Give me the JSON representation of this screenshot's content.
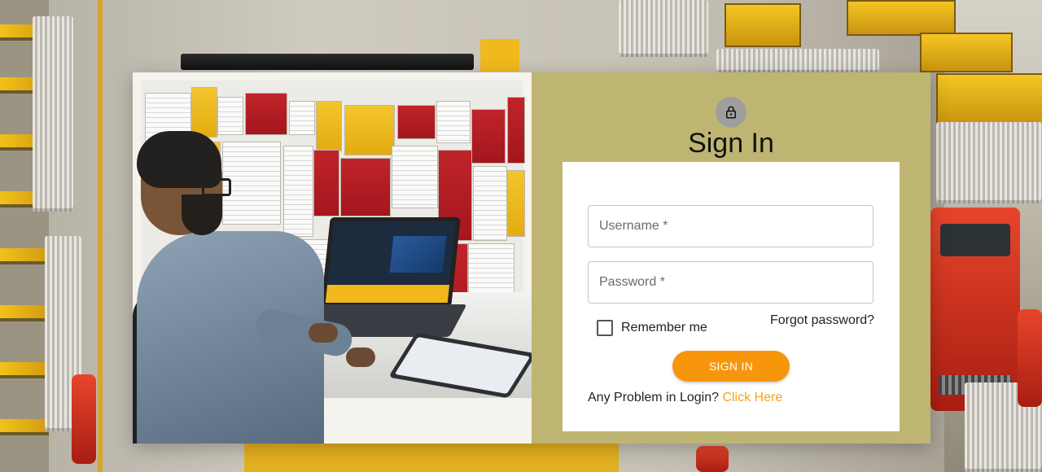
{
  "signin": {
    "title": "Sign In",
    "username_placeholder": "Username *",
    "password_placeholder": "Password *",
    "remember_label": "Remember me",
    "forgot_label": "Forgot password?",
    "button_label": "SIGN IN",
    "problem_text": "Any Problem in Login? ",
    "problem_link": "Click Here"
  },
  "colors": {
    "panel_bg": "#bfb573",
    "button_bg": "#f7960b",
    "link": "#f7a21a",
    "lock_badge": "#9e9e9e"
  },
  "icons": {
    "lock": "lock-icon"
  }
}
